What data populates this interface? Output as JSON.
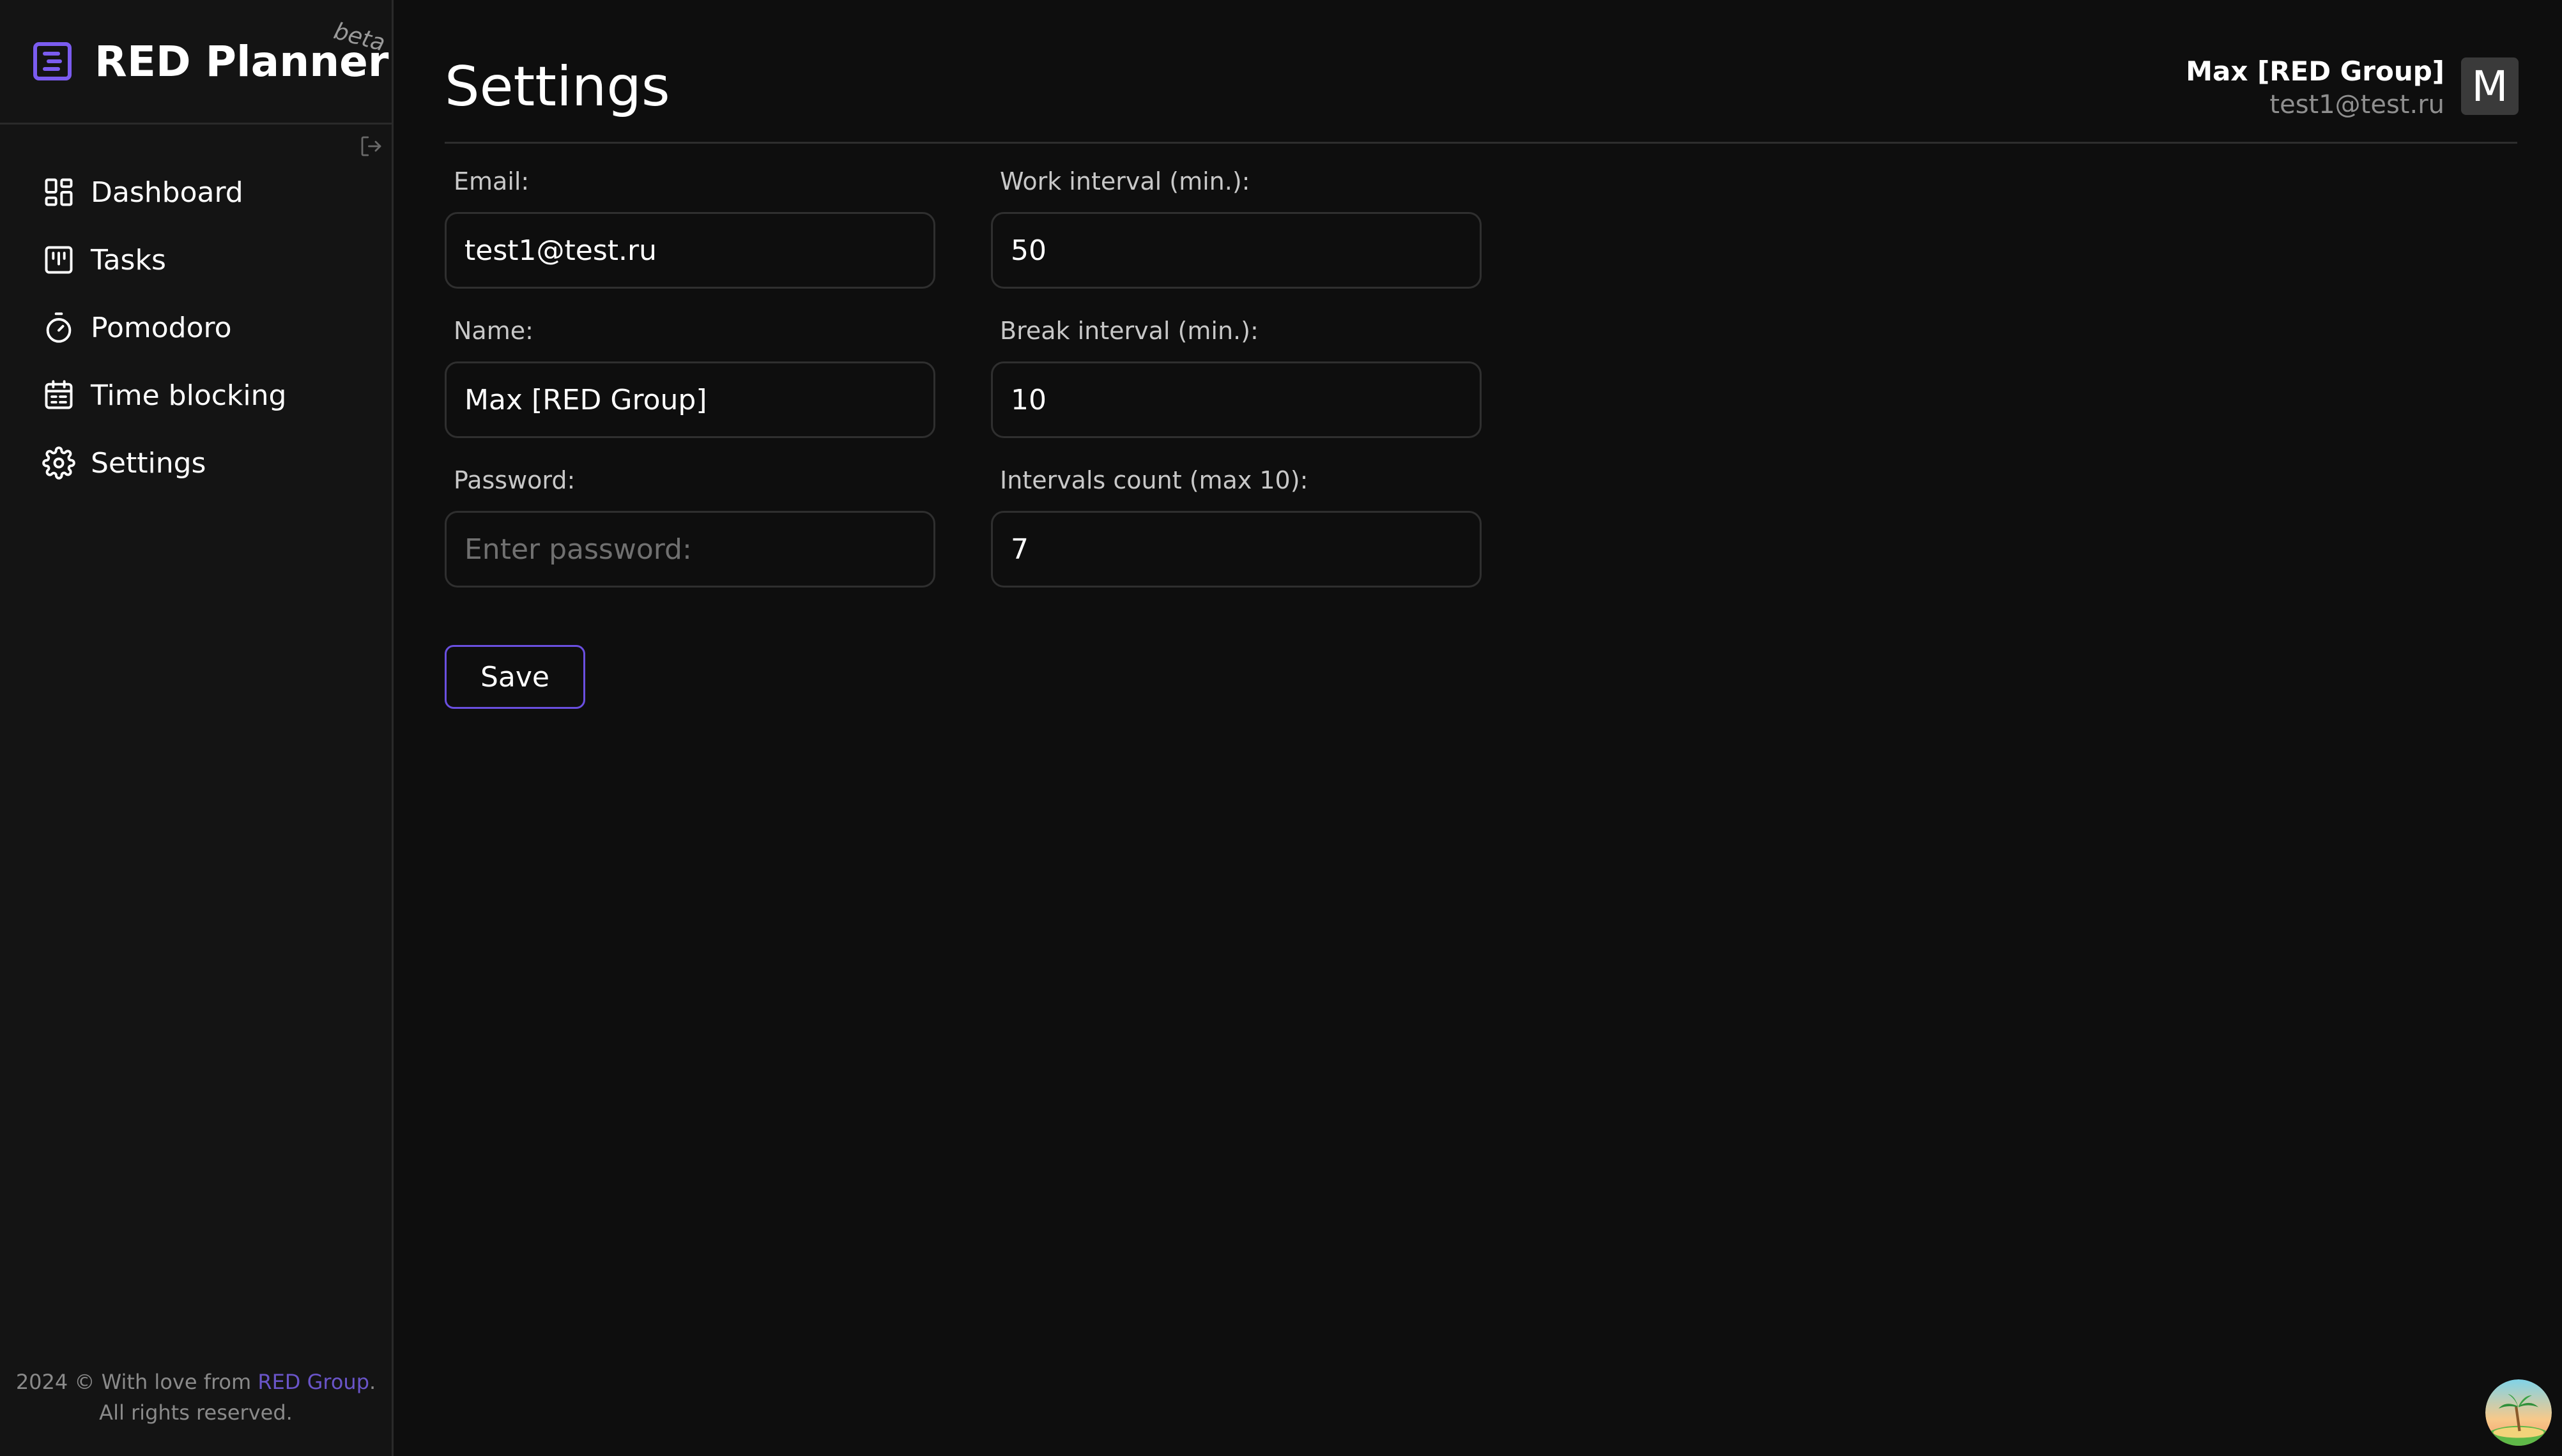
{
  "app": {
    "name": "RED Planner",
    "badge": "beta",
    "accent_color": "#7b5cf0"
  },
  "sidebar": {
    "items": [
      {
        "label": "Dashboard",
        "icon": "dashboard-icon"
      },
      {
        "label": "Tasks",
        "icon": "kanban-icon"
      },
      {
        "label": "Pomodoro",
        "icon": "timer-icon"
      },
      {
        "label": "Time blocking",
        "icon": "calendar-icon"
      },
      {
        "label": "Settings",
        "icon": "gear-icon"
      }
    ],
    "footer": {
      "prefix": "2024 © With love from ",
      "link": "RED Group",
      "suffix": ".",
      "line2": "All rights reserved."
    }
  },
  "header": {
    "title": "Settings",
    "user_name": "Max [RED Group]",
    "user_email": "test1@test.ru",
    "avatar_letter": "M"
  },
  "form": {
    "email": {
      "label": "Email:",
      "value": "test1@test.ru"
    },
    "name": {
      "label": "Name:",
      "value": "Max [RED Group]"
    },
    "password": {
      "label": "Password:",
      "value": "",
      "placeholder": "Enter password:"
    },
    "work_interval": {
      "label": "Work interval (min.):",
      "value": "50"
    },
    "break_interval": {
      "label": "Break interval (min.):",
      "value": "10"
    },
    "intervals_count": {
      "label": "Intervals count (max 10):",
      "value": "7"
    },
    "save_label": "Save"
  }
}
